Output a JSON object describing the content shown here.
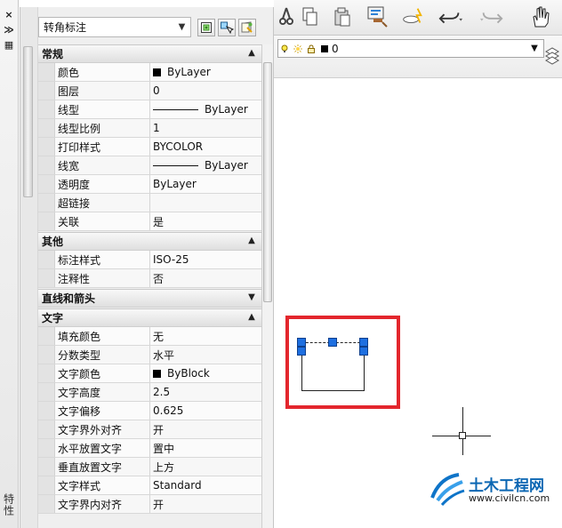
{
  "left_strip": {
    "title": "特性",
    "buttons": [
      "×",
      "≫",
      "▦"
    ]
  },
  "palette": {
    "combo_value": "转角标注",
    "sections": [
      {
        "title": "常规",
        "expanded": true,
        "rows": [
          {
            "name": "颜色",
            "value": "ByLayer",
            "swatch": true
          },
          {
            "name": "图层",
            "value": "0"
          },
          {
            "name": "线型",
            "value": "ByLayer",
            "line": true
          },
          {
            "name": "线型比例",
            "value": "1"
          },
          {
            "name": "打印样式",
            "value": "BYCOLOR"
          },
          {
            "name": "线宽",
            "value": "ByLayer",
            "line": true
          },
          {
            "name": "透明度",
            "value": "ByLayer"
          },
          {
            "name": "超链接",
            "value": ""
          },
          {
            "name": "关联",
            "value": "是"
          }
        ]
      },
      {
        "title": "其他",
        "expanded": true,
        "rows": [
          {
            "name": "标注样式",
            "value": "ISO-25"
          },
          {
            "name": "注释性",
            "value": "否"
          }
        ]
      },
      {
        "title": "直线和箭头",
        "expanded": false,
        "rows": []
      },
      {
        "title": "文字",
        "expanded": true,
        "rows": [
          {
            "name": "填充颜色",
            "value": "无"
          },
          {
            "name": "分数类型",
            "value": "水平"
          },
          {
            "name": "文字颜色",
            "value": "ByBlock",
            "swatch": true
          },
          {
            "name": "文字高度",
            "value": "2.5"
          },
          {
            "name": "文字偏移",
            "value": "0.625"
          },
          {
            "name": "文字界外对齐",
            "value": "开"
          },
          {
            "name": "水平放置文字",
            "value": "置中"
          },
          {
            "name": "垂直放置文字",
            "value": "上方"
          },
          {
            "name": "文字样式",
            "value": "Standard"
          },
          {
            "name": "文字界内对齐",
            "value": "开"
          }
        ]
      }
    ]
  },
  "layer_bar": {
    "current_layer": "0"
  },
  "watermark": {
    "title": "土木工程网",
    "url": "www.civilcn.com"
  },
  "colors": {
    "selection": "#e3262d",
    "grip": "#1e6fe0",
    "watermark_blue": "#0c67b3"
  },
  "icons": [
    "close-icon",
    "auto-hide-icon",
    "properties-icon",
    "quick-select-icon",
    "select-objects-icon",
    "toggle-pickadd-icon",
    "scissors-icon",
    "copy-icon",
    "paste-icon",
    "match-properties-icon",
    "block-editor-icon",
    "undo-icon",
    "redo-icon",
    "pan-hand-icon",
    "lightbulb-icon",
    "sun-icon",
    "lock-icon",
    "color-swatch-icon",
    "layer-stack-icon"
  ]
}
